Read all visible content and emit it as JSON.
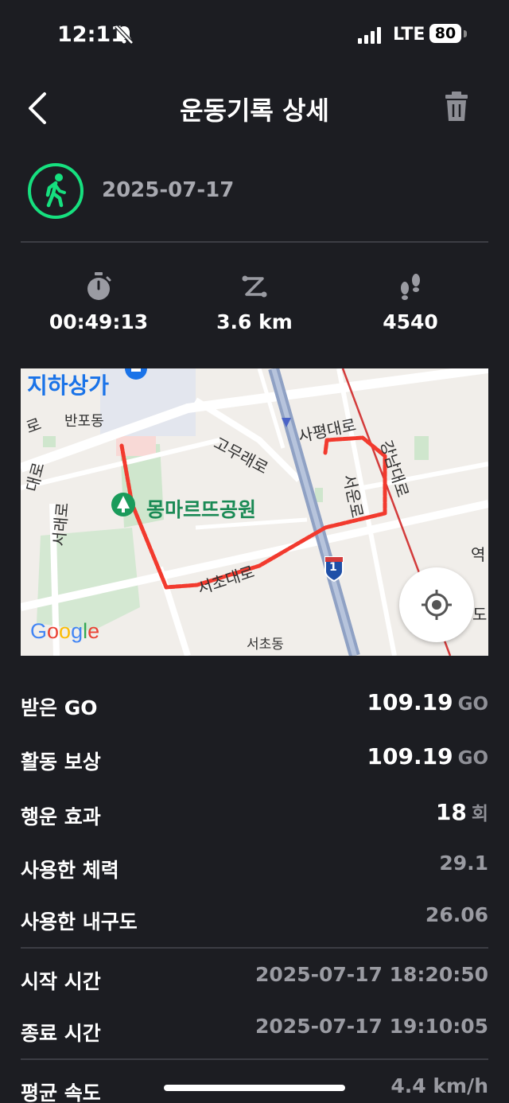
{
  "status_bar": {
    "time": "12:11",
    "network": "LTE",
    "battery": "80"
  },
  "header": {
    "title": "운동기록 상세"
  },
  "activity": {
    "date": "2025-07-17",
    "icon": "walking-person-icon",
    "accent_color": "#16e07f"
  },
  "stats": {
    "duration": "00:49:13",
    "distance": "3.6 km",
    "steps": "4540"
  },
  "map": {
    "labels": {
      "underground_mall": "지하상가",
      "banpodong": "반포동",
      "gomuraero": "고무래로",
      "sapyeongdaero": "사평대로",
      "gangnamdaero": "강남대로",
      "seounro": "서운로",
      "montmartre_park": "몽마르뜨공원",
      "seochodaero": "서초대로",
      "seocheoro": "서래로",
      "seochodong": "서초동",
      "left_edge_road": "대로",
      "left_edge_ro": "로",
      "right_edge_1": "역",
      "right_edge_2": "도",
      "highway_number": "1"
    },
    "attribution": "Google",
    "route_color": "#f23a2e"
  },
  "rows": {
    "received_go": {
      "label": "받은 GO",
      "value": "109.19",
      "unit": "GO"
    },
    "activity_reward": {
      "label": "활동 보상",
      "value": "109.19",
      "unit": "GO"
    },
    "luck_effect": {
      "label": "행운 효과",
      "value": "18",
      "unit": "회"
    },
    "stamina_used": {
      "label": "사용한 체력",
      "value": "29.1"
    },
    "durability_used": {
      "label": "사용한 내구도",
      "value": "26.06"
    },
    "start_time": {
      "label": "시작 시간",
      "value": "2025-07-17 18:20:50"
    },
    "end_time": {
      "label": "종료 시간",
      "value": "2025-07-17 19:10:05"
    },
    "avg_speed": {
      "label": "평균 속도",
      "value": "4.4 km/h"
    }
  }
}
